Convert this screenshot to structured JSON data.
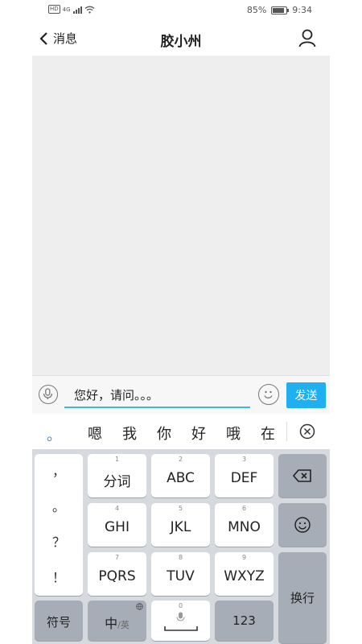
{
  "status": {
    "net": "4G",
    "battery": "85%",
    "battery_level": 0.85,
    "time": "9:34"
  },
  "header": {
    "back_label": "消息",
    "title": "胶小州"
  },
  "input": {
    "value": "您好，请问。。。",
    "send_label": "发送"
  },
  "candidates": {
    "first": "。",
    "words": [
      "嗯",
      "我",
      "你",
      "好",
      "哦",
      "在"
    ]
  },
  "keyboard": {
    "punct": [
      "，",
      "。",
      "？",
      "！"
    ],
    "keys": [
      {
        "num": "1",
        "label": "分词"
      },
      {
        "num": "2",
        "label": "ABC"
      },
      {
        "num": "3",
        "label": "DEF"
      },
      {
        "num": "4",
        "label": "GHI"
      },
      {
        "num": "5",
        "label": "JKL"
      },
      {
        "num": "6",
        "label": "MNO"
      },
      {
        "num": "7",
        "label": "PQRS"
      },
      {
        "num": "8",
        "label": "TUV"
      },
      {
        "num": "9",
        "label": "WXYZ"
      }
    ],
    "symbols_label": "符号",
    "lang_main": "中",
    "lang_sub": "/英",
    "space_num": "0",
    "num123_label": "123",
    "enter_label": "换行"
  },
  "icons": {
    "back": "chevron-left-icon",
    "user": "user-icon",
    "mic": "microphone-icon",
    "emoji": "smiley-icon",
    "close": "circle-x-icon",
    "backspace": "backspace-icon"
  }
}
